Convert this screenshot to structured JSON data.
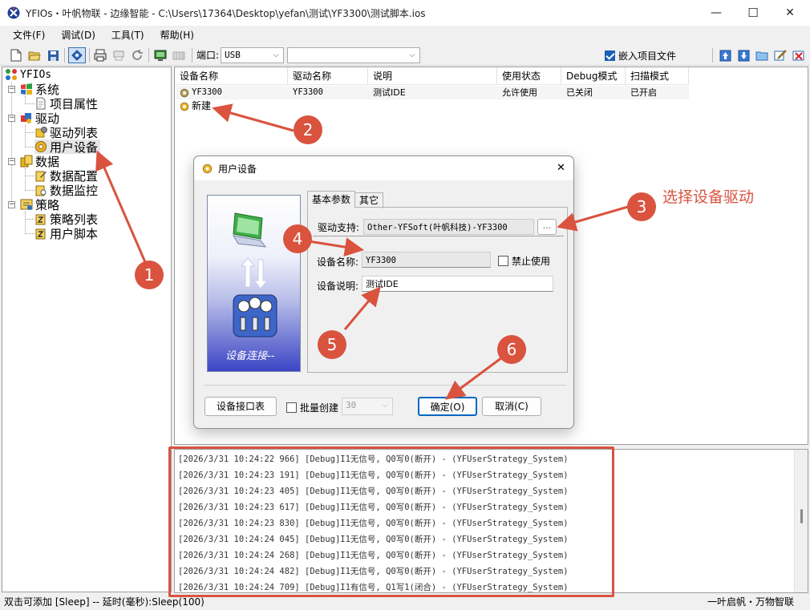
{
  "window": {
    "title": "YFIOs・叶帆物联 - 边缘智能 - C:\\Users\\17364\\Desktop\\yefan\\测试\\YF3300\\测试脚本.ios",
    "min_glyph": "—",
    "max_glyph": "☐",
    "close_glyph": "✕"
  },
  "menu": [
    "文件(F)",
    "调试(D)",
    "工具(T)",
    "帮助(H)"
  ],
  "toolbar": {
    "port_label": "端口:",
    "port_value": "USB",
    "second_combo_value": "",
    "embed_label": "嵌入项目文件",
    "embed_checked": true
  },
  "tree": {
    "root": "YFIOs",
    "groups": [
      {
        "label": "系统",
        "children": [
          "项目属性"
        ]
      },
      {
        "label": "驱动",
        "children": [
          "驱动列表",
          "用户设备"
        ]
      },
      {
        "label": "数据",
        "children": [
          "数据配置",
          "数据监控"
        ]
      },
      {
        "label": "策略",
        "children": [
          "策略列表",
          "用户脚本"
        ]
      }
    ],
    "selected": "用户设备"
  },
  "device_list": {
    "columns": [
      "设备名称",
      "驱动名称",
      "说明",
      "使用状态",
      "Debug模式",
      "扫描模式"
    ],
    "rows": [
      [
        "YF3300",
        "YF3300",
        "测试IDE",
        "允许使用",
        "已关闭",
        "已开启"
      ]
    ],
    "new_item": "新建"
  },
  "dialog": {
    "title": "用户设备",
    "picture_caption": "设备连接--",
    "tabs": [
      "基本参数",
      "其它"
    ],
    "active_tab": "基本参数",
    "driver_label": "驱动支持:",
    "driver_value": "Other-YFSoft(叶帆科技)-YF3300",
    "browse_label": "...",
    "name_label": "设备名称:",
    "name_value": "YF3300",
    "disable_label": "禁止使用",
    "disable_checked": false,
    "desc_label": "设备说明:",
    "desc_value": "测试IDE",
    "iface_button": "设备接口表",
    "batch_label": "批量创建",
    "batch_checked": false,
    "batch_count": "30",
    "ok_button": "确定(O)",
    "cancel_button": "取消(C)",
    "close_glyph": "✕"
  },
  "log": [
    "[2026/3/31 10:24:22 966] [Debug]I1无信号, Q0写0(断开) - (YFUserStrategy_System)",
    "[2026/3/31 10:24:23 191] [Debug]I1无信号, Q0写0(断开) - (YFUserStrategy_System)",
    "[2026/3/31 10:24:23 405] [Debug]I1无信号, Q0写0(断开) - (YFUserStrategy_System)",
    "[2026/3/31 10:24:23 617] [Debug]I1无信号, Q0写0(断开) - (YFUserStrategy_System)",
    "[2026/3/31 10:24:23 830] [Debug]I1无信号, Q0写0(断开) - (YFUserStrategy_System)",
    "[2026/3/31 10:24:24 045] [Debug]I1无信号, Q0写0(断开) - (YFUserStrategy_System)",
    "[2026/3/31 10:24:24 268] [Debug]I1无信号, Q0写0(断开) - (YFUserStrategy_System)",
    "[2026/3/31 10:24:24 482] [Debug]I1无信号, Q0写0(断开) - (YFUserStrategy_System)",
    "[2026/3/31 10:24:24 709] [Debug]I1有信号, Q1写1(闭合) - (YFUserStrategy_System)"
  ],
  "status": {
    "left": "双击可添加 [Sleep] -- 延时(毫秒):Sleep(100)",
    "right": "一叶启帆・万物智联"
  },
  "annotations": {
    "markers": [
      "1",
      "2",
      "3",
      "4",
      "5",
      "6"
    ],
    "note3": "选择设备驱动",
    "color": "#d9533f"
  }
}
